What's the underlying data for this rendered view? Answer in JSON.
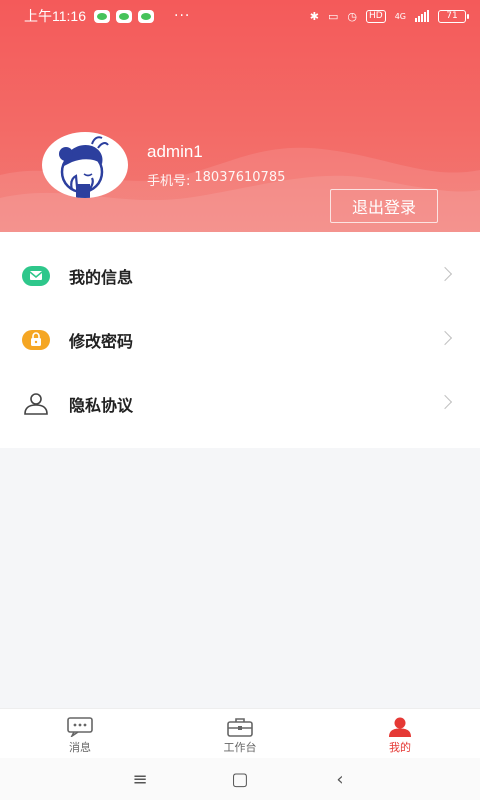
{
  "status_bar": {
    "time": "上午11:16",
    "more": "···",
    "battery": "71",
    "network": "4G"
  },
  "profile": {
    "username": "admin1",
    "phone_label": "手机号:",
    "phone": "18037610785",
    "logout_label": "退出登录"
  },
  "menu": {
    "items": [
      {
        "label": "我的信息",
        "icon": "message-card-icon",
        "color": "#2ec78b"
      },
      {
        "label": "修改密码",
        "icon": "lock-icon",
        "color": "#f5a623"
      },
      {
        "label": "隐私协议",
        "icon": "user-outline-icon",
        "color": "#444444"
      }
    ]
  },
  "tabbar": {
    "tabs": [
      {
        "label": "消息",
        "icon": "chat-icon"
      },
      {
        "label": "工作台",
        "icon": "briefcase-icon"
      },
      {
        "label": "我的",
        "icon": "person-icon",
        "active": true
      }
    ]
  },
  "colors": {
    "header": "#f45a5a",
    "accent": "#e53935"
  }
}
